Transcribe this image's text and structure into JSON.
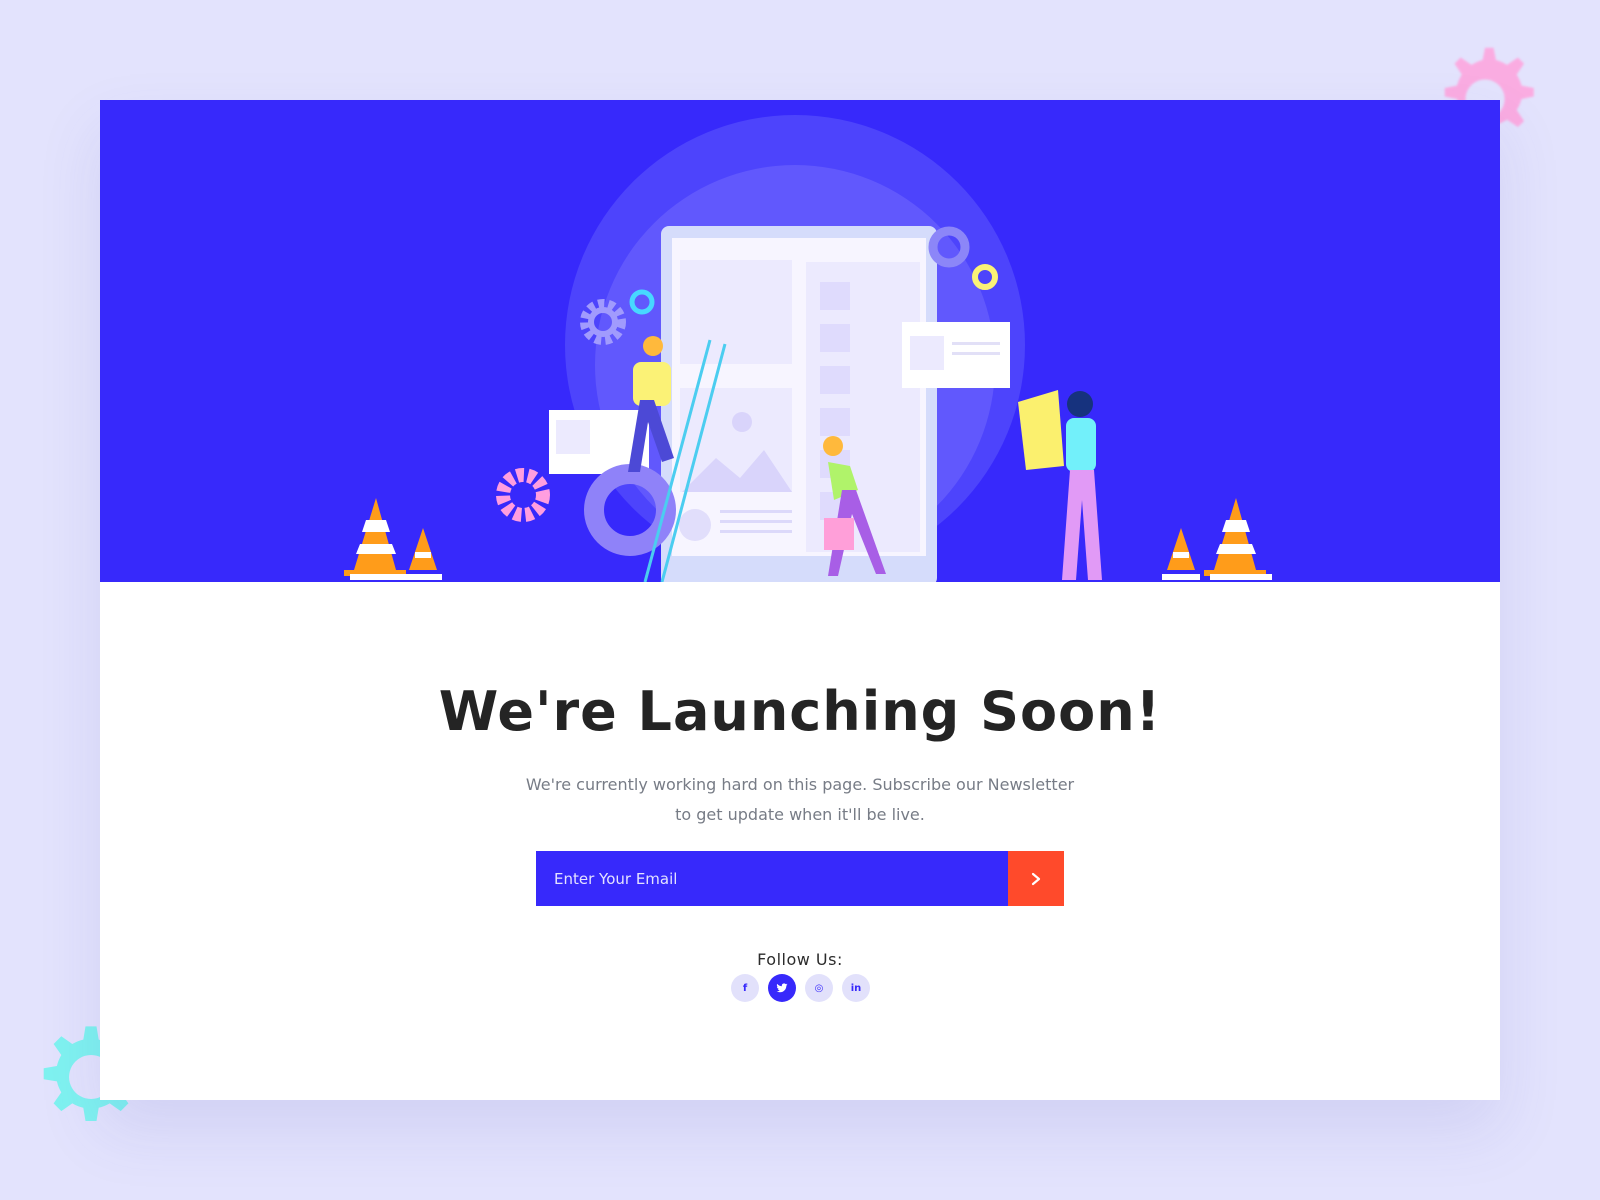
{
  "hero": {
    "background_color": "#3729fb",
    "illustration": "construction-workers-building-web-page"
  },
  "main": {
    "title": "We're Launching Soon!",
    "subtitle": "We're currently working hard on this page. Subscribe our Newsletter to get update when it'll be live."
  },
  "newsletter": {
    "email_placeholder": "Enter Your Email",
    "email_value": "",
    "submit_icon": "chevron-right-icon",
    "accent_color": "#ff4a2b"
  },
  "social": {
    "label": "Follow Us:",
    "links": [
      {
        "icon": "facebook-icon",
        "glyph": "f",
        "active": false
      },
      {
        "icon": "twitter-icon",
        "glyph": "t",
        "active": true
      },
      {
        "icon": "instagram-icon",
        "glyph": "◎",
        "active": false
      },
      {
        "icon": "linkedin-icon",
        "glyph": "in",
        "active": false
      }
    ]
  }
}
